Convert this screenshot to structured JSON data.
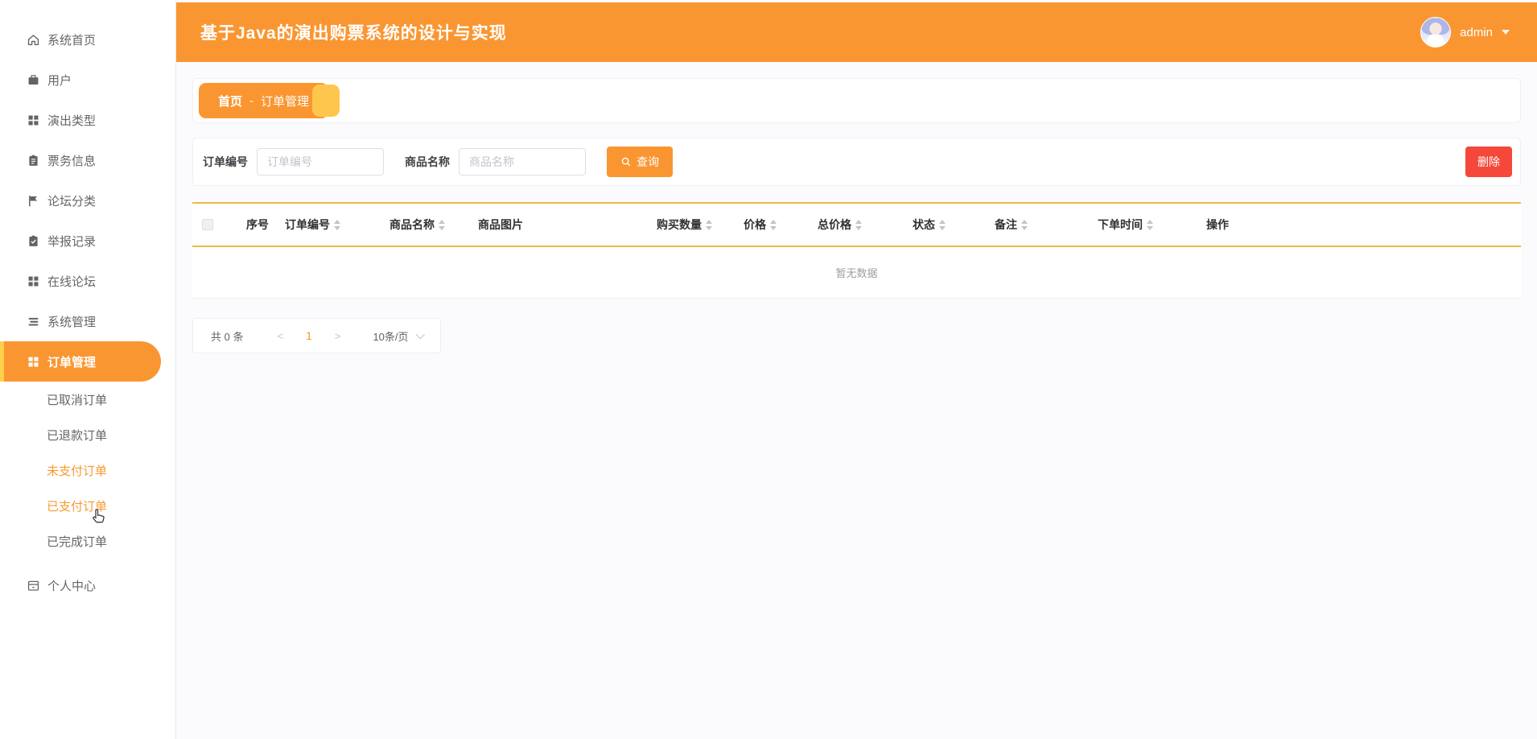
{
  "header": {
    "title": "基于Java的演出购票系统的设计与实现",
    "username": "admin"
  },
  "breadcrumb": {
    "home": "首页",
    "separator": "-",
    "current": "订单管理"
  },
  "sidebar": {
    "items": [
      {
        "label": "系统首页",
        "icon": "home-icon"
      },
      {
        "label": "用户",
        "icon": "briefcase-icon"
      },
      {
        "label": "演出类型",
        "icon": "grid-icon"
      },
      {
        "label": "票务信息",
        "icon": "clipboard-icon"
      },
      {
        "label": "论坛分类",
        "icon": "flag-icon"
      },
      {
        "label": "举报记录",
        "icon": "clipboard-check-icon"
      },
      {
        "label": "在线论坛",
        "icon": "grid-icon"
      },
      {
        "label": "系统管理",
        "icon": "lines-icon"
      },
      {
        "label": "订单管理",
        "icon": "grid-icon",
        "active": true
      }
    ],
    "order_sub_items": [
      {
        "label": "已取消订单",
        "highlight": false
      },
      {
        "label": "已退款订单",
        "highlight": false
      },
      {
        "label": "未支付订单",
        "highlight": true
      },
      {
        "label": "已支付订单",
        "highlight": true
      },
      {
        "label": "已完成订单",
        "highlight": false
      }
    ],
    "bottom_item": {
      "label": "个人中心",
      "icon": "card-icon"
    }
  },
  "search": {
    "order_no_label": "订单编号",
    "order_no_placeholder": "订单编号",
    "order_no_value": "",
    "product_label": "商品名称",
    "product_placeholder": "商品名称",
    "product_value": "",
    "query_button": "查询",
    "delete_button": "删除"
  },
  "table": {
    "columns": [
      {
        "label": "序号",
        "sortable": false
      },
      {
        "label": "订单编号",
        "sortable": true
      },
      {
        "label": "商品名称",
        "sortable": true
      },
      {
        "label": "商品图片",
        "sortable": false
      },
      {
        "label": "购买数量",
        "sortable": true
      },
      {
        "label": "价格",
        "sortable": true
      },
      {
        "label": "总价格",
        "sortable": true
      },
      {
        "label": "状态",
        "sortable": true
      },
      {
        "label": "备注",
        "sortable": true
      },
      {
        "label": "下单时间",
        "sortable": true
      },
      {
        "label": "操作",
        "sortable": false
      }
    ],
    "rows": [],
    "empty_text": "暂无数据"
  },
  "pagination": {
    "total_label": "共 0 条",
    "prev_label": "<",
    "current_page": "1",
    "next_label": ">",
    "page_size_label": "10条/页"
  },
  "colors": {
    "theme_orange": "#fa9632",
    "badge_tab_yellow": "#ffc64d",
    "active_bar_yellow": "#ffd04b",
    "delete_red": "#f5483b",
    "table_line_gold": "#e6bd45"
  }
}
